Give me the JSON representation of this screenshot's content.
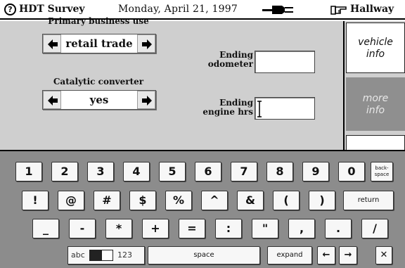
{
  "status_bar": {
    "app_title": "HDT Survey",
    "date": "Monday, April 21, 1997",
    "destination": "Hallway"
  },
  "form": {
    "primary_business": {
      "label": "Primary business use",
      "value": "retail trade"
    },
    "catalytic_converter": {
      "label": "Catalytic converter",
      "value": "yes"
    },
    "ending_odometer": {
      "label_line1": "Ending",
      "label_line2": "odometer",
      "value": ""
    },
    "ending_engine_hrs": {
      "label_line1": "Ending",
      "label_line2": "engine hrs",
      "value": ""
    }
  },
  "tabs": {
    "vehicle": {
      "line1": "vehicle",
      "line2": "info"
    },
    "more": {
      "line1": "more",
      "line2": "info"
    }
  },
  "keyboard": {
    "row1": [
      "1",
      "2",
      "3",
      "4",
      "5",
      "6",
      "7",
      "8",
      "9",
      "0"
    ],
    "backspace_line1": "back-",
    "backspace_line2": "space",
    "row2": [
      "!",
      "@",
      "#",
      "$",
      "%",
      "^",
      "&",
      "(",
      ")"
    ],
    "return": "return",
    "row3": [
      "_",
      "-",
      "*",
      "+",
      "=",
      ":",
      "\"",
      ",",
      ".",
      "/"
    ],
    "mode_left": "abc",
    "mode_right": "123",
    "space": "space",
    "expand": "expand",
    "arrow_left": "←",
    "arrow_right": "→",
    "close": "✕"
  }
}
